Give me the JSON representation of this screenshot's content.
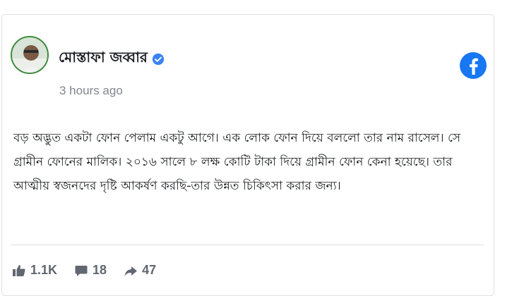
{
  "post": {
    "author_name": "মোস্তাফা জব্বার",
    "timestamp": "3 hours ago",
    "text": "বড় অদ্ভুত একটা ফোন পেলাম একটু আগে। এক লোক ফোন দিয়ে বললো তার নাম রাসেল। সে গ্রামীন ফোনের মালিক। ২০১৬ সালে ৮ লক্ষ কোটি টাকা দিয়ে গ্রামীন ফোন কেনা হয়েছে। তার আত্মীয় স্বজনদের দৃষ্টি আকর্ষণ করছি-তার উন্নত চিকিৎসা করার জন্য।",
    "reactions": {
      "likes": "1.1K",
      "comments": "18",
      "shares": "47"
    }
  },
  "icons": {
    "brand": "facebook-logo",
    "verified": "verified-badge",
    "like": "thumbs-up-icon",
    "comment": "comment-icon",
    "share": "share-icon"
  },
  "colors": {
    "facebook_blue": "#1877f2",
    "verified_blue": "#3b82f6",
    "muted_text": "#7f868d",
    "action_text": "#606770"
  }
}
